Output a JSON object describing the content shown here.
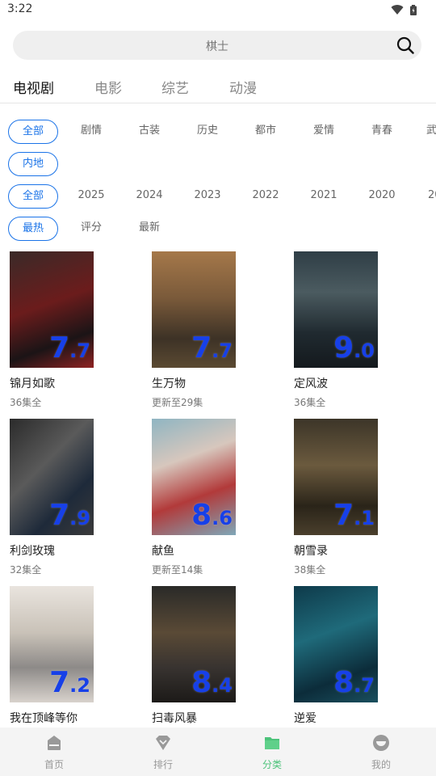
{
  "status_bar": {
    "time": "3:22"
  },
  "search": {
    "placeholder": "棋士"
  },
  "top_tabs": [
    {
      "label": "电视剧",
      "active": true
    },
    {
      "label": "电影",
      "active": false
    },
    {
      "label": "综艺",
      "active": false
    },
    {
      "label": "动漫",
      "active": false
    }
  ],
  "filters": {
    "genre": [
      "全部",
      "剧情",
      "古装",
      "历史",
      "都市",
      "爱情",
      "青春",
      "武"
    ],
    "region": [
      "内地"
    ],
    "year": [
      "全部",
      "2025",
      "2024",
      "2023",
      "2022",
      "2021",
      "2020",
      "20"
    ],
    "sort": [
      "最热",
      "评分",
      "最新"
    ]
  },
  "posters": [
    {
      "title": "锦月如歌",
      "subtitle": "36集全",
      "rating_int": "7",
      "rating_dec": ".7"
    },
    {
      "title": "生万物",
      "subtitle": "更新至29集",
      "rating_int": "7",
      "rating_dec": ".7"
    },
    {
      "title": "定风波",
      "subtitle": "36集全",
      "rating_int": "9",
      "rating_dec": ".0"
    },
    {
      "title": "利剑玫瑰",
      "subtitle": "32集全",
      "rating_int": "7",
      "rating_dec": ".9"
    },
    {
      "title": "献鱼",
      "subtitle": "更新至14集",
      "rating_int": "8",
      "rating_dec": ".6"
    },
    {
      "title": "朝雪录",
      "subtitle": "38集全",
      "rating_int": "7",
      "rating_dec": ".1"
    },
    {
      "title": "我在顶峰等你",
      "subtitle": "",
      "rating_int": "7",
      "rating_dec": ".2"
    },
    {
      "title": "扫毒风暴",
      "subtitle": "",
      "rating_int": "8",
      "rating_dec": ".4"
    },
    {
      "title": "逆爱",
      "subtitle": "",
      "rating_int": "8",
      "rating_dec": ".7"
    }
  ],
  "bottom_nav": [
    {
      "label": "首页",
      "icon": "home-icon",
      "active": false
    },
    {
      "label": "排行",
      "icon": "ranking-icon",
      "active": false
    },
    {
      "label": "分类",
      "icon": "category-folder-icon",
      "active": true
    },
    {
      "label": "我的",
      "icon": "profile-icon",
      "active": false
    }
  ],
  "colors": {
    "accent": "#1a73e8",
    "rating": "#1740e8",
    "nav_active": "#4cc37a",
    "nav_inactive": "#999999"
  }
}
